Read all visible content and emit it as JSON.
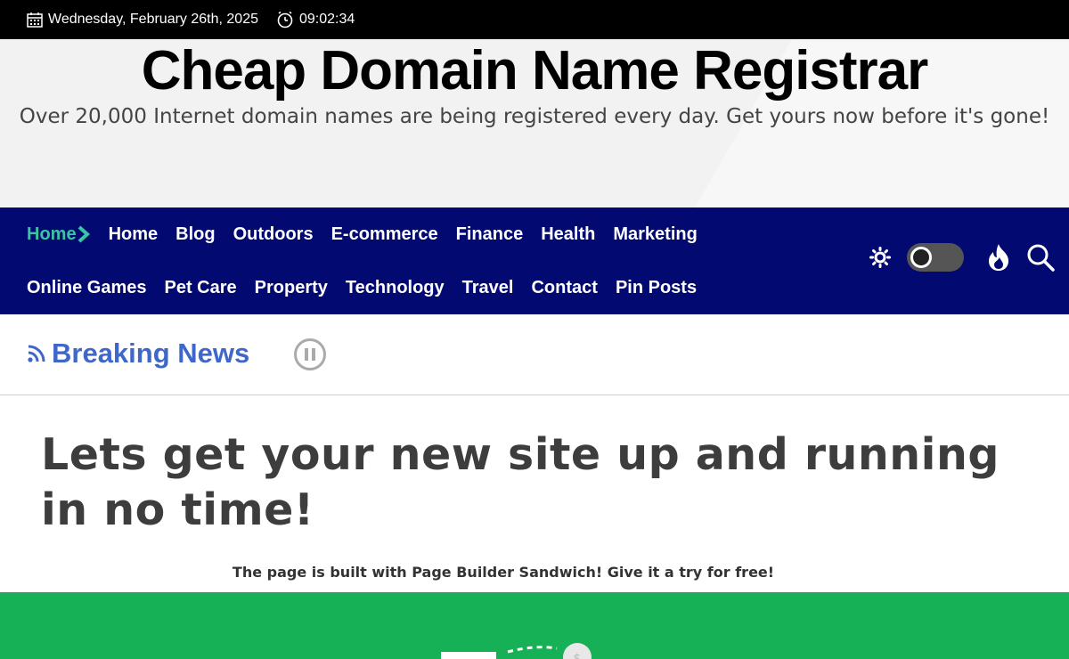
{
  "topbar": {
    "date": "Wednesday, February 26th, 2025",
    "time": "09:02:34"
  },
  "header": {
    "title": "Cheap Domain Name Registrar",
    "tagline": "Over 20,000 Internet domain names are being registered every day. Get yours now before it's gone!"
  },
  "nav": {
    "row1": [
      "Home",
      "Home",
      "Blog",
      "Outdoors",
      "E-commerce",
      "Finance",
      "Health",
      "Marketing"
    ],
    "row2": [
      "Online Games",
      "Pet Care",
      "Property",
      "Technology",
      "Travel",
      "Contact",
      "Pin Posts"
    ],
    "active_color": "#3ac5a1",
    "bg_color": "#020a72"
  },
  "breaking": {
    "label": "Breaking News"
  },
  "main": {
    "headline": "Lets get your new site up and running in no time!",
    "subtext": "The page is built with Page Builder Sandwich! Give it a try for free!"
  },
  "colors": {
    "accent_green": "#16b056",
    "breaking_blue": "#3e67c9"
  },
  "icons": [
    "calendar-icon",
    "clock-icon",
    "sun-icon",
    "fire-icon",
    "search-icon",
    "rss-icon",
    "pause-icon",
    "chevron-right-icon"
  ]
}
